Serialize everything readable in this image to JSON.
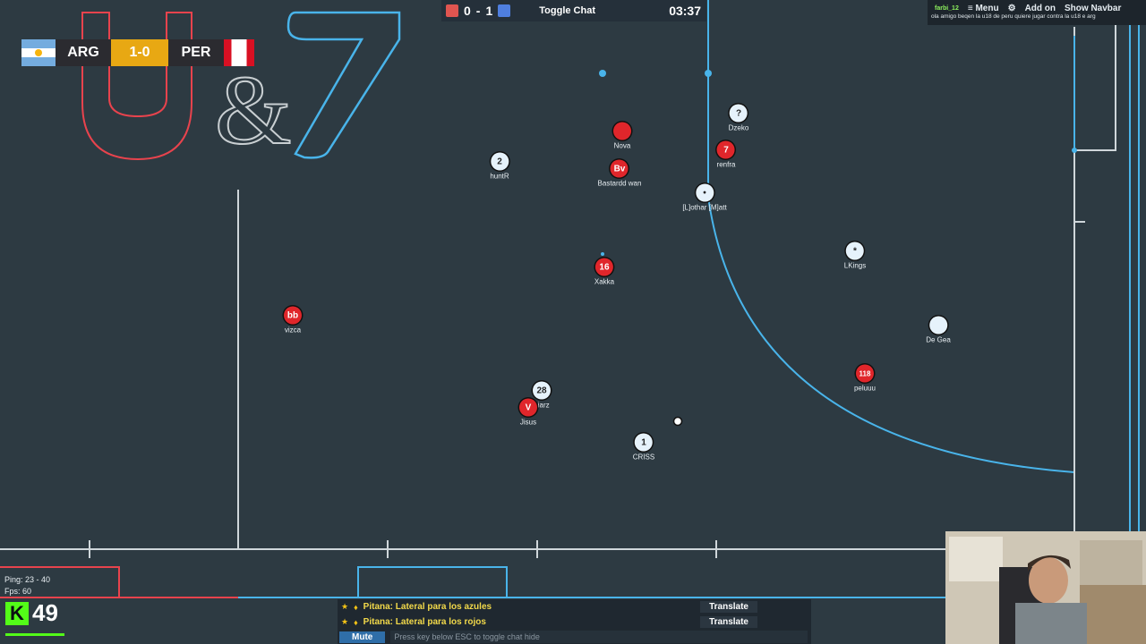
{
  "topbar": {
    "score_red": "0",
    "score_dash": "-",
    "score_blue": "1",
    "toggle_chat": "Toggle Chat",
    "timer": "03:37",
    "red_color": "#e05550",
    "blue_color": "#4f7fe0"
  },
  "scoreboard": {
    "home": "ARG",
    "score": "1-0",
    "away": "PER"
  },
  "topright": {
    "username": "farbi_12",
    "menu": "≡ Menu",
    "settings_icon": "⚙",
    "addon": "Add on",
    "navbar": "Show Navbar",
    "message": "ola amigo beqen la u18 de peru quiere jugar contra la u18 e arg"
  },
  "logo": {
    "text_left": "U",
    "text_mid": "&",
    "text_right": "7"
  },
  "players": [
    {
      "number": "",
      "name": "Nova",
      "team": "red"
    },
    {
      "number": "Bv",
      "name": "Bastardd wan",
      "team": "red"
    },
    {
      "number": "7",
      "name": "renfra",
      "team": "red"
    },
    {
      "number": "?",
      "name": "Dzeko",
      "team": "blue"
    },
    {
      "number": "2",
      "name": "huntR",
      "team": "blue"
    },
    {
      "number": "•",
      "name": "[L]othar [M]att",
      "team": "blue"
    },
    {
      "number": "16",
      "name": "Xakka",
      "team": "red"
    },
    {
      "number": "*",
      "name": "LKings",
      "team": "blue"
    },
    {
      "number": "bb",
      "name": "vizca",
      "team": "red"
    },
    {
      "number": "",
      "name": "De Gea",
      "team": "blue"
    },
    {
      "number": "118",
      "name": "peluuu",
      "team": "red"
    },
    {
      "number": "28",
      "name": "biarz",
      "team": "blue"
    },
    {
      "number": "V",
      "name": "Jisus",
      "team": "red"
    },
    {
      "number": "1",
      "name": "CRISS",
      "team": "blue"
    }
  ],
  "hud": {
    "ping": "Ping: 23 - 40",
    "fps": "Fps: 60",
    "kick_letter": "K",
    "kick_count": "49"
  },
  "chat": {
    "messages": [
      {
        "text": "Pitana: Lateral para los azules",
        "translate": "Translate"
      },
      {
        "text": "Pitana: Lateral para los rojos",
        "translate": "Translate"
      }
    ],
    "mute": "Mute",
    "placeholder": "Press key below ESC to toggle chat hide"
  }
}
